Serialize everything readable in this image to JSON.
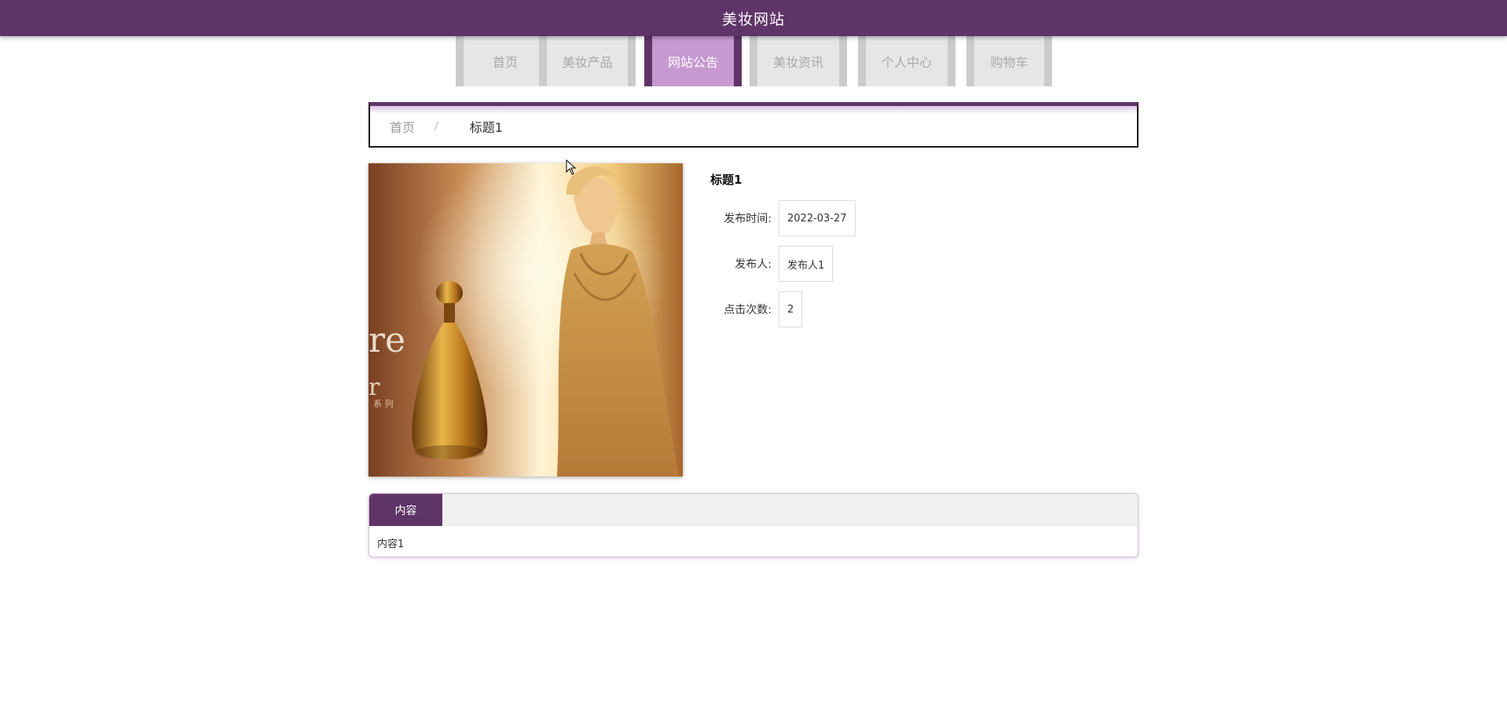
{
  "header": {
    "title": "美妆网站"
  },
  "nav": {
    "items": [
      {
        "label": "首页"
      },
      {
        "label": "美妆产品"
      },
      {
        "label": "网站公告",
        "active": true
      },
      {
        "label": "美妆资讯"
      },
      {
        "label": "个人中心"
      },
      {
        "label": "购物车"
      }
    ]
  },
  "breadcrumb": {
    "home": "首页",
    "separator": "/",
    "current": "标题1"
  },
  "detail": {
    "title": "标题1",
    "fields": [
      {
        "label": "发布时间:",
        "value": "2022-03-27"
      },
      {
        "label": "发布人:",
        "value": "发布人1"
      },
      {
        "label": "点击次数:",
        "value": "2"
      }
    ]
  },
  "content": {
    "tab_label": "内容",
    "body": "内容1"
  },
  "colors": {
    "brand": "#5f3468",
    "active_tab": "#c799d0",
    "nav_bg": "#e6e6e6"
  }
}
